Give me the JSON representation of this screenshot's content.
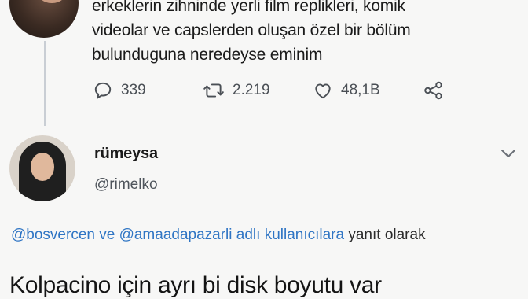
{
  "previous_tweet": {
    "text_lines": [
      "erkeklerin zihninde yerli film replikleri, komik",
      "videolar ve capslerden oluşan özel bir bölüm",
      "bulunduguna neredeyse eminim"
    ],
    "actions": {
      "reply_count": "339",
      "retweet_count": "2.219",
      "like_count": "48,1B"
    }
  },
  "reply": {
    "display_name": "rümeysa",
    "handle": "@rimelko",
    "reply_to": {
      "mention_1": "@bosvercen",
      "connector": " ve ",
      "mention_2": "@amaadapazarli",
      "middle_text": " adlı kullanıcılara",
      "suffix": " yanıt olarak"
    },
    "text": "Kolpacino için ayrı bi disk boyutu var"
  },
  "colors": {
    "background": "#f7f7f6",
    "mention": "#2f75c4",
    "icon_gray": "#4a4f55",
    "thread_line": "#c9ced4"
  },
  "icons": [
    "reply-icon",
    "retweet-icon",
    "like-icon",
    "share-icon",
    "chevron-down-icon"
  ]
}
